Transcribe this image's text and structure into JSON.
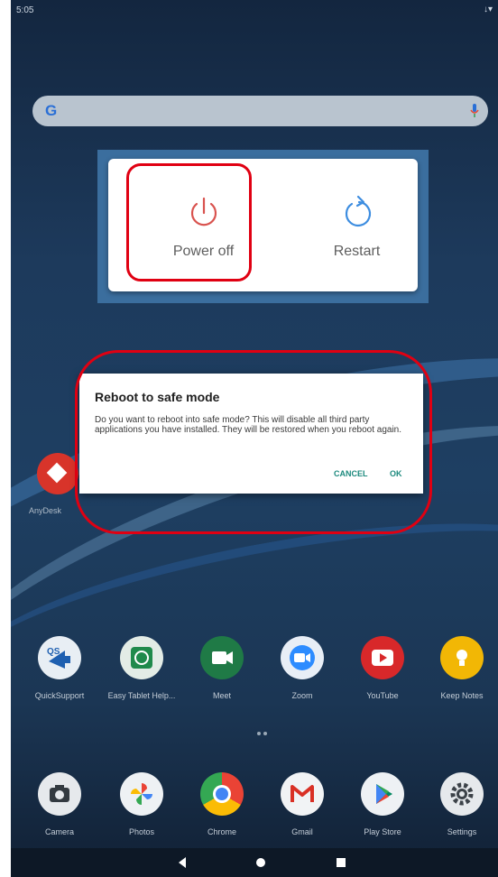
{
  "status_bar": {
    "time": "5:05",
    "icons": "↓▾"
  },
  "search": {
    "logo": "G"
  },
  "power_menu": {
    "power_off_label": "Power off",
    "restart_label": "Restart"
  },
  "dialog": {
    "title": "Reboot to safe mode",
    "body": "Do you want to reboot into safe mode? This will disable all third party applications you have installed. They will be restored when you reboot again.",
    "cancel_label": "CANCEL",
    "ok_label": "OK"
  },
  "anydesk": {
    "label": "AnyDesk"
  },
  "apps_row1": [
    {
      "label": "QuickSupport"
    },
    {
      "label": "Easy Tablet Help..."
    },
    {
      "label": "Meet"
    },
    {
      "label": "Zoom"
    },
    {
      "label": "YouTube"
    },
    {
      "label": "Keep Notes"
    }
  ],
  "apps_row2": [
    {
      "label": "Camera"
    },
    {
      "label": "Photos"
    },
    {
      "label": "Chrome"
    },
    {
      "label": "Gmail"
    },
    {
      "label": "Play Store"
    },
    {
      "label": "Settings"
    }
  ],
  "colors": {
    "highlight": "#e00012",
    "dialog_button": "#1d8a7e",
    "power_icon": "#d9534f",
    "restart_icon": "#3d8de0"
  }
}
